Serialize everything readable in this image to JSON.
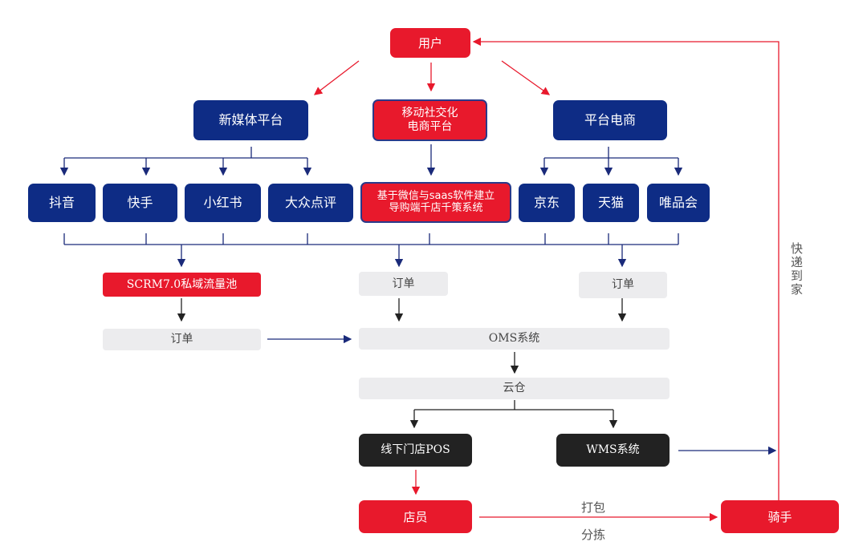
{
  "colors": {
    "red": "#e8192c",
    "navy": "#0e2c85",
    "grey": "#ececee",
    "dark": "#222222"
  },
  "nodes": {
    "user": "用户",
    "new_media": "新媒体平台",
    "mobile_social": "移动社交化\n电商平台",
    "platform_ecom": "平台电商",
    "douyin": "抖音",
    "kuaishou": "快手",
    "xiaohongshu": "小红书",
    "dianping": "大众点评",
    "wechat_saas": "基于微信与saas软件建立\n导购端千店千策系统",
    "jd": "京东",
    "tmall": "天猫",
    "vip": "唯品会",
    "scrm": "SCRM7.0私域流量池",
    "order_left": "订单",
    "order_mid": "订单",
    "order_right": "订单",
    "oms": "OMS系统",
    "cloud_wh": "云仓",
    "pos": "线下门店POS",
    "wms": "WMS系统",
    "clerk": "店员",
    "rider": "骑手"
  },
  "labels": {
    "pack": "打包",
    "sort": "分拣",
    "express": "快递到家"
  }
}
